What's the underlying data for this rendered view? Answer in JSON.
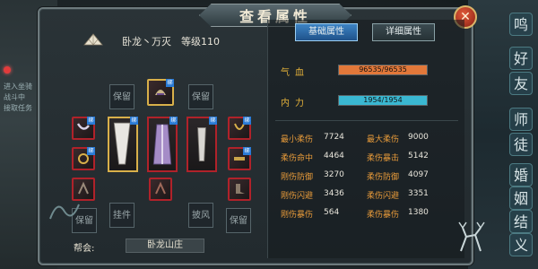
{
  "window": {
    "title": "查看属性",
    "close_glyph": "✕"
  },
  "background": {
    "right_chars": [
      "鸣",
      "好",
      "友",
      "师",
      "徒",
      "婚",
      "姻",
      "结",
      "义"
    ],
    "left_texts": [
      "进入坐骑",
      "战斗中",
      "接取任务"
    ]
  },
  "character": {
    "name": "卧龙丶万灭",
    "level_text": "等级110",
    "guild_label": "帮会:",
    "guild_name": "卧龙山庄"
  },
  "equipment": {
    "empty_slots": {
      "top_left": "保留",
      "top_right": "保留",
      "bottom_left": "保留",
      "pendant": "挂件",
      "cloak": "披风",
      "bottom_right": "保留"
    },
    "tag_text": "绑",
    "colors": {
      "red_border": "#b0222a",
      "gold_border": "#d8b04a"
    }
  },
  "tabs": [
    {
      "label": "基础属性",
      "active": true
    },
    {
      "label": "详细属性",
      "active": false
    }
  ],
  "bars": {
    "hp": {
      "label": "气血",
      "text": "96535/96535",
      "current": 96535,
      "max": 96535,
      "color": "#e2783a"
    },
    "mp": {
      "label": "内力",
      "text": "1954/1954",
      "current": 1954,
      "max": 1954,
      "color": "#3ab8d2"
    }
  },
  "stats": [
    {
      "name": "最小柔伤",
      "value": "7724"
    },
    {
      "name": "最大柔伤",
      "value": "9000"
    },
    {
      "name": "柔伤命中",
      "value": "4464"
    },
    {
      "name": "柔伤暴击",
      "value": "5142"
    },
    {
      "name": "刚伤防御",
      "value": "3270"
    },
    {
      "name": "柔伤防御",
      "value": "4097"
    },
    {
      "name": "刚伤闪避",
      "value": "3436"
    },
    {
      "name": "柔伤闪避",
      "value": "3351"
    },
    {
      "name": "刚伤暴伤",
      "value": "564"
    },
    {
      "name": "柔伤暴伤",
      "value": "1380"
    }
  ]
}
